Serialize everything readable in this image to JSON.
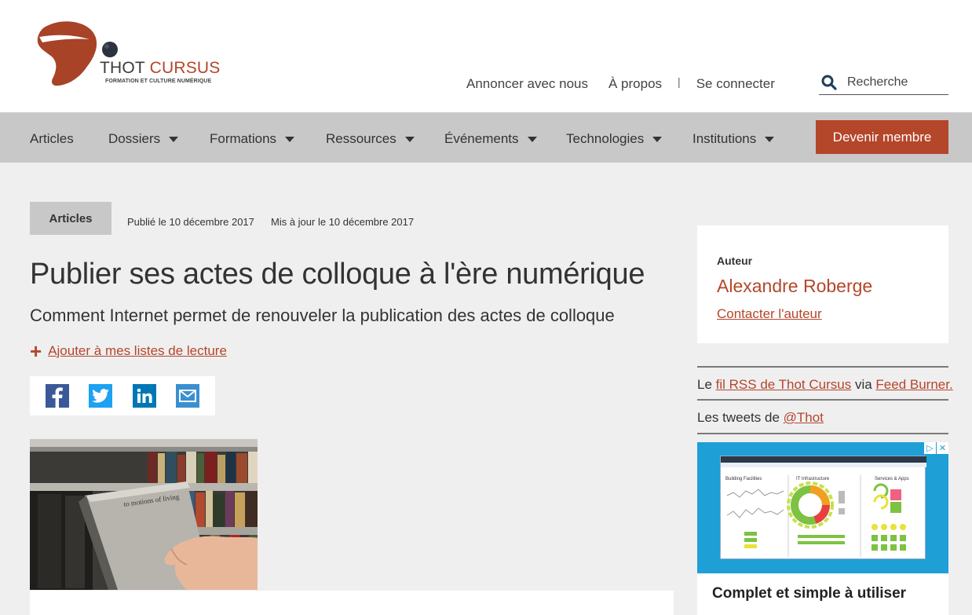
{
  "brand": {
    "name_part1": "THOT",
    "name_part2": "CURSUS",
    "tagline": "FORMATION ET CULTURE NUMÉRIQUE"
  },
  "topnav": {
    "advertise": "Annoncer avec nous",
    "about": "À propos",
    "separator": "|",
    "login": "Se connecter"
  },
  "search": {
    "placeholder": "Recherche"
  },
  "mainnav": {
    "items": [
      {
        "label": "Articles",
        "has_dropdown": false
      },
      {
        "label": "Dossiers",
        "has_dropdown": true
      },
      {
        "label": "Formations",
        "has_dropdown": true
      },
      {
        "label": "Ressources",
        "has_dropdown": true
      },
      {
        "label": "Événements",
        "has_dropdown": true
      },
      {
        "label": "Technologies",
        "has_dropdown": true
      },
      {
        "label": "Institutions",
        "has_dropdown": true
      }
    ],
    "cta": "Devenir membre"
  },
  "article": {
    "category": "Articles",
    "published": "Publié le 10 décembre 2017",
    "updated": "Mis à jour le 10 décembre 2017",
    "title": "Publier ses actes de colloque à l'ère numérique",
    "subtitle": "Comment Internet permet de renouveler la publication des actes de colloque",
    "reading_list_plus": "+",
    "reading_list": "Ajouter à mes listes de lecture",
    "share": [
      "facebook-icon",
      "twitter-icon",
      "linkedin-icon",
      "email-icon"
    ],
    "image_caption_text": "to motions of living"
  },
  "sidebar": {
    "author_label": "Auteur",
    "author_name": "Alexandre Roberge",
    "contact": "Contacter l'auteur",
    "rss_prefix": "Le ",
    "rss_link": "fil RSS de Thot Cursus",
    "rss_mid": " via ",
    "rss_link2": "Feed Burner.",
    "tweets_prefix": "Les tweets de ",
    "tweets_link": "@Thot",
    "ad_headline": "Complet et simple à utiliser",
    "ad_screen": {
      "panel1": "Building Facilities",
      "panel2": "IT Infrastructure",
      "panel3": "Services & Apps"
    },
    "ad_badges": [
      "▷",
      "✕"
    ]
  },
  "colors": {
    "accent": "#b4462a",
    "nav_bg": "#c8c8c8",
    "page_bg": "#efeff0",
    "facebook": "#3b5998",
    "twitter": "#1da1f2",
    "linkedin": "#0077b5",
    "email": "#3a8fd1"
  }
}
